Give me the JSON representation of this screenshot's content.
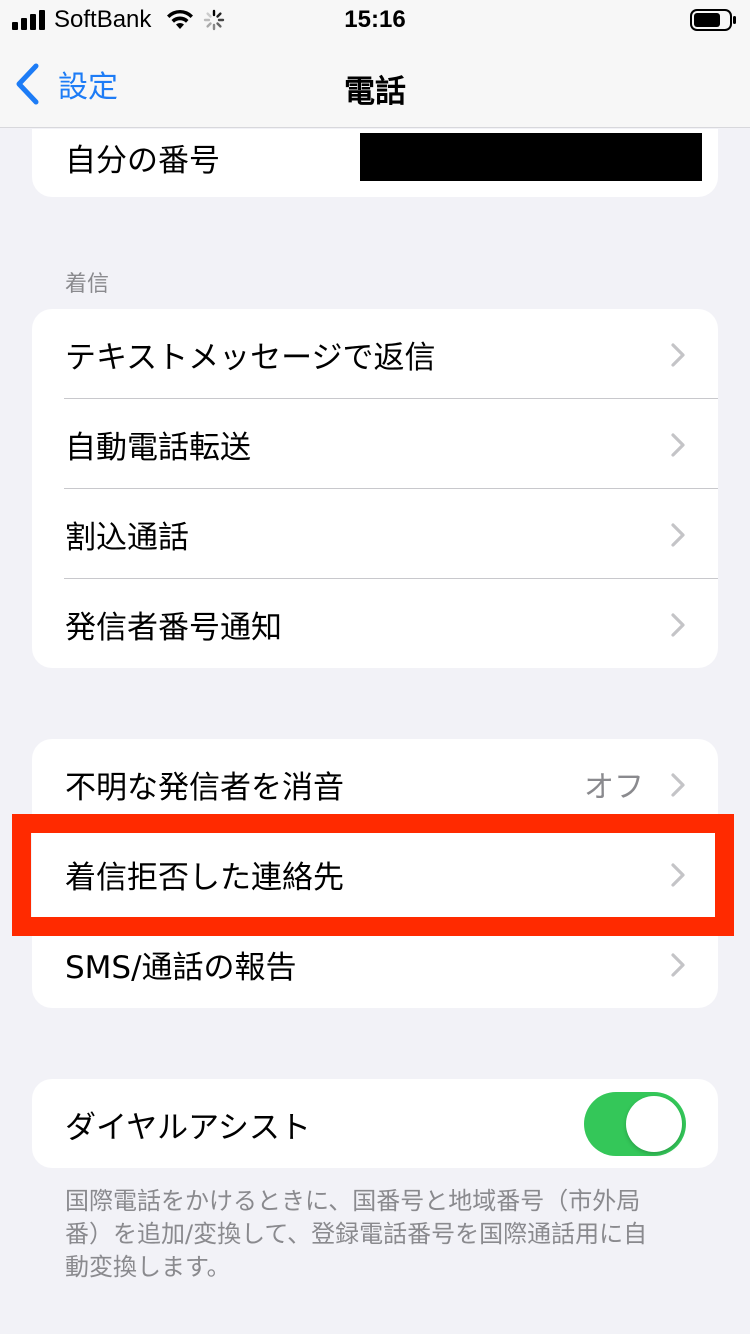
{
  "status_bar": {
    "carrier": "SoftBank",
    "time": "15:16"
  },
  "nav": {
    "back_label": "設定",
    "title": "電話"
  },
  "my_number": {
    "label": "自分の番号"
  },
  "incoming_section": {
    "header": "着信",
    "items": [
      {
        "label": "テキストメッセージで返信"
      },
      {
        "label": "自動電話転送"
      },
      {
        "label": "割込通話"
      },
      {
        "label": "発信者番号通知"
      }
    ]
  },
  "blocking_section": {
    "items": [
      {
        "label": "不明な発信者を消音",
        "value": "オフ"
      },
      {
        "label": "着信拒否した連絡先"
      },
      {
        "label": "SMS/通話の報告"
      }
    ]
  },
  "dial_assist": {
    "label": "ダイヤルアシスト",
    "enabled": true,
    "footer_lines": [
      "国際電話をかけるときに、国番号と地域番号（市外局",
      "番）を追加/変換して、登録電話番号を国際通話用に自",
      "動変換します。"
    ]
  },
  "colors": {
    "accent": "#1d7cf6",
    "toggle_on": "#34c759",
    "highlight": "#ff2a00",
    "background": "#f2f2f7"
  }
}
